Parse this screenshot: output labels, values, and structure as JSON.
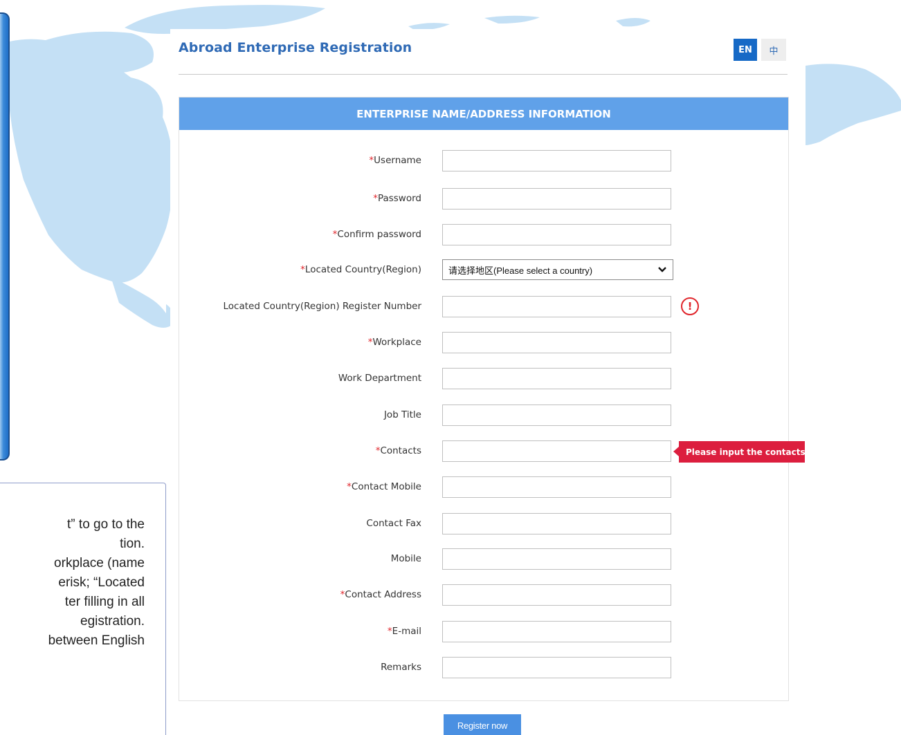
{
  "header": {
    "title": "Abroad Enterprise Registration",
    "lang_en": "EN",
    "lang_zh": "中"
  },
  "section": {
    "title": "ENTERPRISE NAME/ADDRESS INFORMATION"
  },
  "fields": [
    {
      "label": "Username",
      "required": true,
      "value": ""
    },
    {
      "label": "Password",
      "required": true,
      "value": ""
    },
    {
      "label": "Confirm password",
      "required": true,
      "value": ""
    },
    {
      "label": "Located Country(Region)",
      "required": true,
      "type": "select",
      "selected": "请选择地区(Please select a country)"
    },
    {
      "label": "Located Country(Region) Register Number",
      "required": false,
      "value": "",
      "icon": "warning-circle-icon"
    },
    {
      "label": "Workplace",
      "required": true,
      "value": ""
    },
    {
      "label": "Work Department",
      "required": false,
      "value": ""
    },
    {
      "label": "Job Title",
      "required": false,
      "value": ""
    },
    {
      "label": "Contacts",
      "required": true,
      "value": "",
      "error": "Please input the contacts."
    },
    {
      "label": "Contact Mobile",
      "required": true,
      "value": ""
    },
    {
      "label": "Contact Fax",
      "required": false,
      "value": ""
    },
    {
      "label": "Mobile",
      "required": false,
      "value": ""
    },
    {
      "label": "Contact Address",
      "required": true,
      "value": ""
    },
    {
      "label": "E-mail",
      "required": true,
      "value": ""
    },
    {
      "label": "Remarks",
      "required": false,
      "value": ""
    }
  ],
  "required_mark": "*",
  "submit_label": "Register now",
  "note": {
    "lines": [
      "t” to go to the",
      "tion.",
      "orkplace (name",
      "erisk; “Located",
      "ter filling in all",
      "egistration.",
      "between English"
    ]
  },
  "colors": {
    "accent": "#1669c6",
    "section_bar": "#60a1e9",
    "required": "#e0252b",
    "error_tooltip": "#dc1e3e",
    "map": "#bcdcf3"
  }
}
